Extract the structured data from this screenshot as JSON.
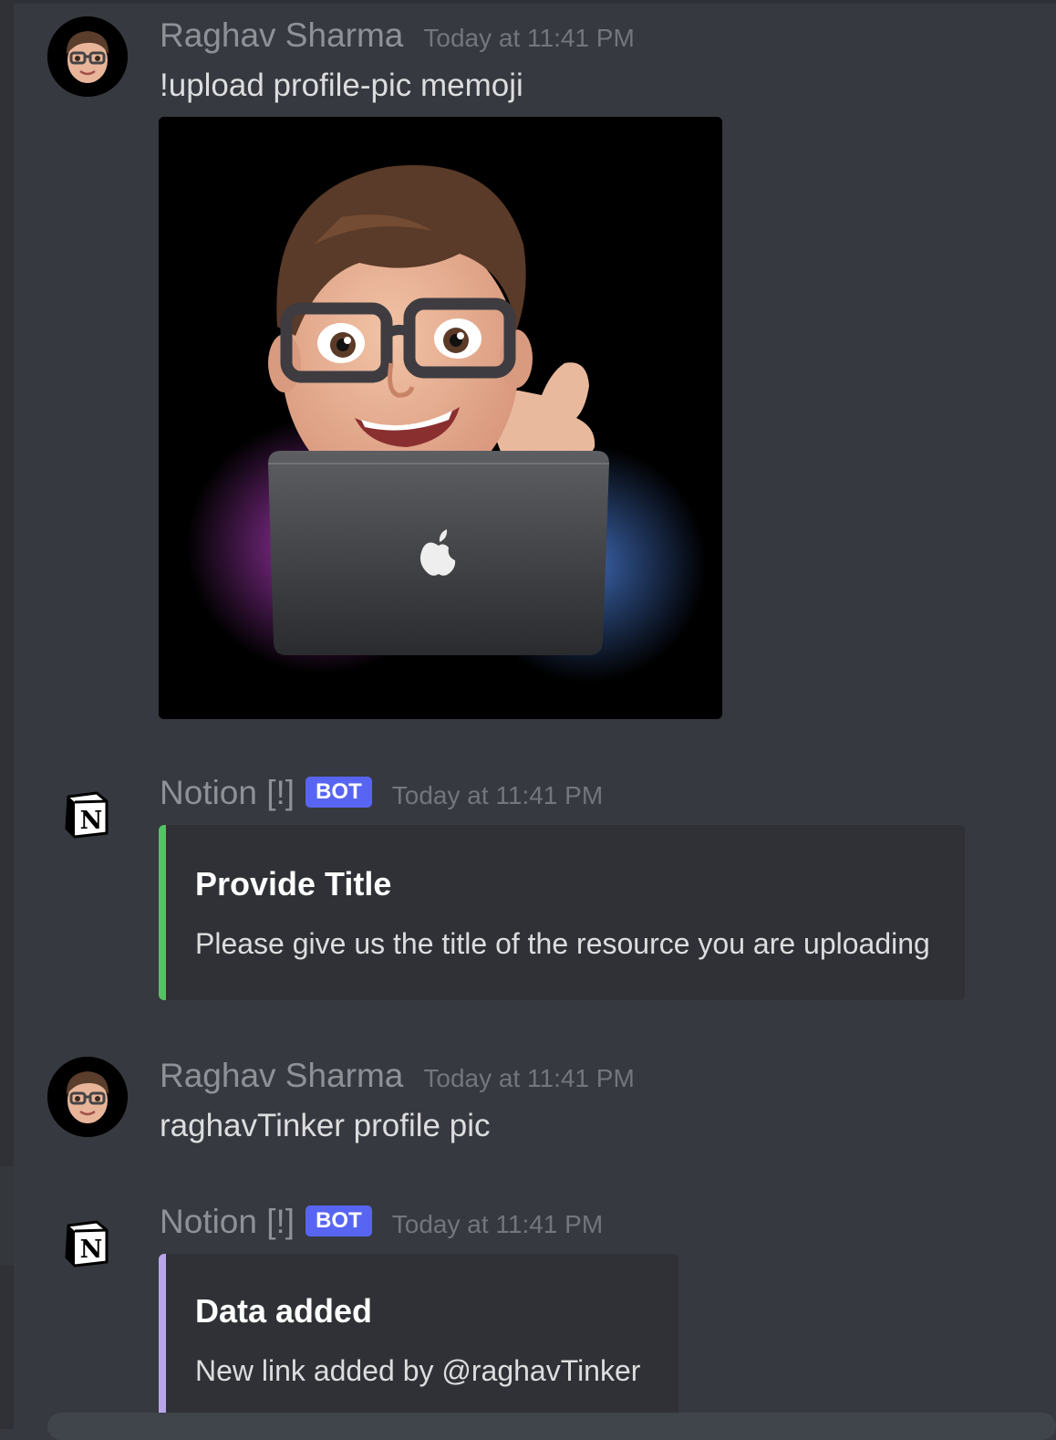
{
  "colors": {
    "background": "#36393f",
    "embed_background": "#2f3136",
    "bot_tag": "#5865f2",
    "embed_bar_provide_title": "#57c265",
    "embed_bar_data_added": "#b9a5e8"
  },
  "messages": [
    {
      "author": "Raghav Sharma",
      "timestamp": "Today at 11:41 PM",
      "avatar_icon": "memoji-avatar-icon",
      "text": "!upload profile-pic memoji",
      "attachment_icon": "memoji-laptop-image"
    },
    {
      "author": "Notion [!]",
      "bot_tag": "BOT",
      "timestamp": "Today at 11:41 PM",
      "avatar_icon": "notion-logo-icon",
      "embed": {
        "title": "Provide Title",
        "description": "Please give us the title of the resource you are uploading"
      }
    },
    {
      "author": "Raghav Sharma",
      "timestamp": "Today at 11:41 PM",
      "avatar_icon": "memoji-avatar-icon",
      "text": "raghavTinker profile pic"
    },
    {
      "author": "Notion [!]",
      "bot_tag": "BOT",
      "timestamp": "Today at 11:41 PM",
      "avatar_icon": "notion-logo-icon",
      "embed": {
        "title": "Data added",
        "description": "New link added by @raghavTinker"
      }
    }
  ]
}
